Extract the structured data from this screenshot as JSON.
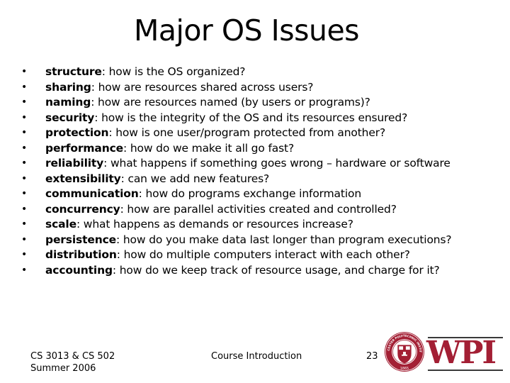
{
  "slide": {
    "title": "Major OS Issues",
    "bullet_glyph": "•",
    "bullets": [
      {
        "term": "structure",
        "text": ": how is the OS organized?"
      },
      {
        "term": "sharing",
        "text": ": how are resources shared across users?"
      },
      {
        "term": "naming",
        "text": ": how are resources named (by users or programs)?"
      },
      {
        "term": "security",
        "text": ": how is the integrity of the OS and its resources ensured?"
      },
      {
        "term": "protection",
        "text": ": how is one user/program protected from another?"
      },
      {
        "term": "performance",
        "text": ": how do we make it all go fast?"
      },
      {
        "term": "reliability",
        "text": ": what happens if something goes wrong – hardware or software"
      },
      {
        "term": "extensibility",
        "text": ": can we add new features?"
      },
      {
        "term": "communication",
        "text": ": how do programs exchange information"
      },
      {
        "term": "concurrency",
        "text": ": how are parallel activities created and controlled?"
      },
      {
        "term": "scale",
        "text": ": what happens as demands or resources increase?"
      },
      {
        "term": "persistence",
        "text": ": how do you make data last longer than program executions?"
      },
      {
        "term": "distribution",
        "text": ": how do multiple computers interact with each other?"
      },
      {
        "term": "accounting",
        "text": ": how do we keep track of resource usage, and charge for it?"
      }
    ]
  },
  "footer": {
    "course_line1": "CS 3013 & CS 502",
    "course_line2": "Summer 2006",
    "section": "Course Introduction",
    "page_number": "23"
  },
  "logo": {
    "wordmark": "WPI",
    "seal_year": "1865",
    "seal_text": "WORCESTER POLYTECHNIC INSTITUTE",
    "brand_color": "#a31f34"
  }
}
